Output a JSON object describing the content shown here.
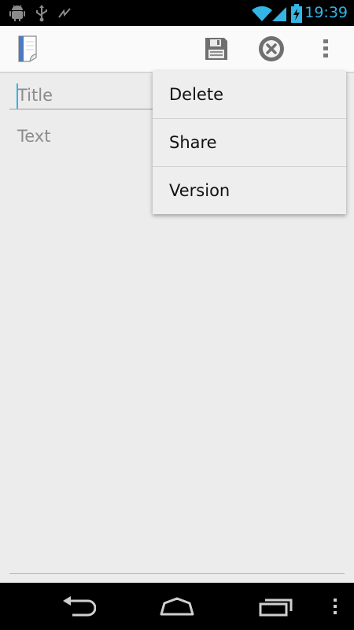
{
  "status_bar": {
    "time": "19:39",
    "accent_color": "#33b5e5",
    "icons": [
      "android-debug-icon",
      "usb-icon",
      "activity-icon",
      "wifi-icon",
      "signal-icon",
      "battery-charging-icon"
    ]
  },
  "action_bar": {
    "app_icon": "notepad-icon",
    "actions": [
      "save-icon",
      "discard-icon",
      "overflow-menu-icon"
    ]
  },
  "editor": {
    "title_placeholder": "Title",
    "text_placeholder": "Text"
  },
  "menu": {
    "items": [
      {
        "label": "Delete"
      },
      {
        "label": "Share"
      },
      {
        "label": "Version"
      }
    ]
  },
  "nav_bar": {
    "buttons": [
      "back-icon",
      "home-icon",
      "recent-apps-icon",
      "menu-icon"
    ]
  }
}
